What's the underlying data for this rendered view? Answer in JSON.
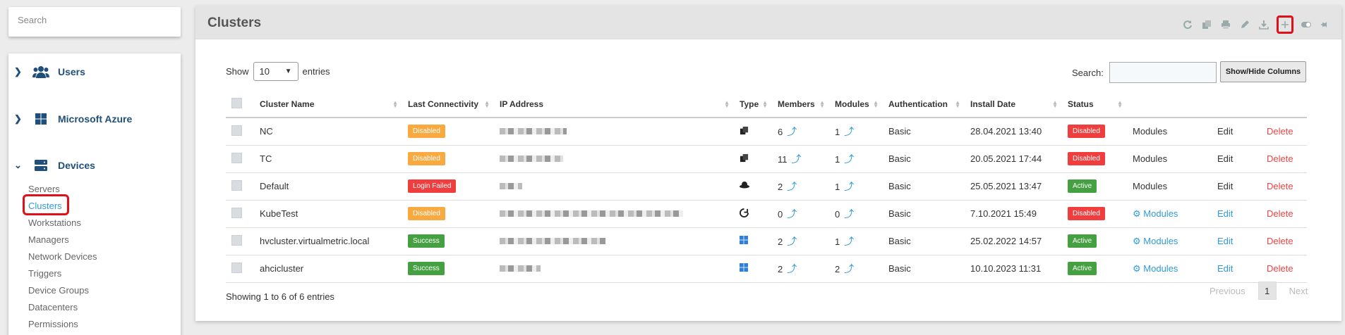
{
  "sidebar": {
    "search_placeholder": "Search",
    "sections": [
      {
        "label": "Users",
        "icon": "users-icon"
      },
      {
        "label": "Microsoft Azure",
        "icon": "windows-icon"
      },
      {
        "label": "Devices",
        "icon": "server-icon"
      }
    ],
    "device_items": [
      "Servers",
      "Clusters",
      "Workstations",
      "Managers",
      "Network Devices",
      "Triggers",
      "Device Groups",
      "Datacenters",
      "Permissions"
    ],
    "active_item": "Clusters"
  },
  "main": {
    "title": "Clusters",
    "toolbar": [
      "refresh-icon",
      "copy-icon",
      "print-icon",
      "edit-icon",
      "download-icon",
      "add-icon",
      "toggle-icon",
      "pin-icon"
    ],
    "show_label": "Show",
    "entries_value": "10",
    "entries_label": "entries",
    "search_label": "Search:",
    "show_hide_label": "Show/Hide Columns",
    "columns": [
      "Cluster Name",
      "Last Connectivity",
      "IP Address",
      "Type",
      "Members",
      "Modules",
      "Authentication",
      "Install Date",
      "Status"
    ],
    "rows": [
      {
        "name": "NC",
        "conn": "Disabled",
        "conn_color": "#f8a940",
        "type": "copy",
        "members": "6",
        "modules": "1",
        "auth": "Basic",
        "date": "28.04.2021 13:40",
        "status": "Disabled",
        "status_color": "#f03e3e",
        "mod_link": "Modules",
        "mod_icon": false,
        "edit": "Edit",
        "delete": "Delete"
      },
      {
        "name": "TC",
        "conn": "Disabled",
        "conn_color": "#f8a940",
        "type": "copy",
        "members": "11",
        "modules": "1",
        "auth": "Basic",
        "date": "20.05.2021 17:44",
        "status": "Disabled",
        "status_color": "#f03e3e",
        "mod_link": "Modules",
        "mod_icon": false,
        "edit": "Edit",
        "delete": "Delete"
      },
      {
        "name": "Default",
        "conn": "Login Failed",
        "conn_color": "#f03e3e",
        "type": "hat",
        "members": "2",
        "modules": "1",
        "auth": "Basic",
        "date": "25.05.2021 13:47",
        "status": "Active",
        "status_color": "#44a040",
        "mod_link": "Modules",
        "mod_icon": false,
        "edit": "Edit",
        "delete": "Delete"
      },
      {
        "name": "KubeTest",
        "conn": "Disabled",
        "conn_color": "#f8a940",
        "type": "kube",
        "members": "0",
        "modules": "0",
        "auth": "Basic",
        "date": "7.10.2021 15:49",
        "status": "Disabled",
        "status_color": "#f03e3e",
        "mod_link": "Modules",
        "mod_icon": true,
        "edit": "Edit",
        "delete": "Delete"
      },
      {
        "name": "hvcluster.virtualmetric.local",
        "conn": "Success",
        "conn_color": "#44a040",
        "type": "windows",
        "members": "2",
        "modules": "1",
        "auth": "Basic",
        "date": "25.02.2022 14:57",
        "status": "Active",
        "status_color": "#44a040",
        "mod_link": "Modules",
        "mod_icon": true,
        "edit": "Edit",
        "delete": "Delete"
      },
      {
        "name": "ahcicluster",
        "conn": "Success",
        "conn_color": "#44a040",
        "type": "windows",
        "members": "2",
        "modules": "2",
        "auth": "Basic",
        "date": "10.10.2023 11:31",
        "status": "Active",
        "status_color": "#44a040",
        "mod_link": "Modules",
        "mod_icon": true,
        "edit": "Edit",
        "delete": "Delete"
      }
    ],
    "footer": "Showing 1 to 6 of 6 entries",
    "pager": {
      "previous": "Previous",
      "page": "1",
      "next": "Next"
    }
  }
}
